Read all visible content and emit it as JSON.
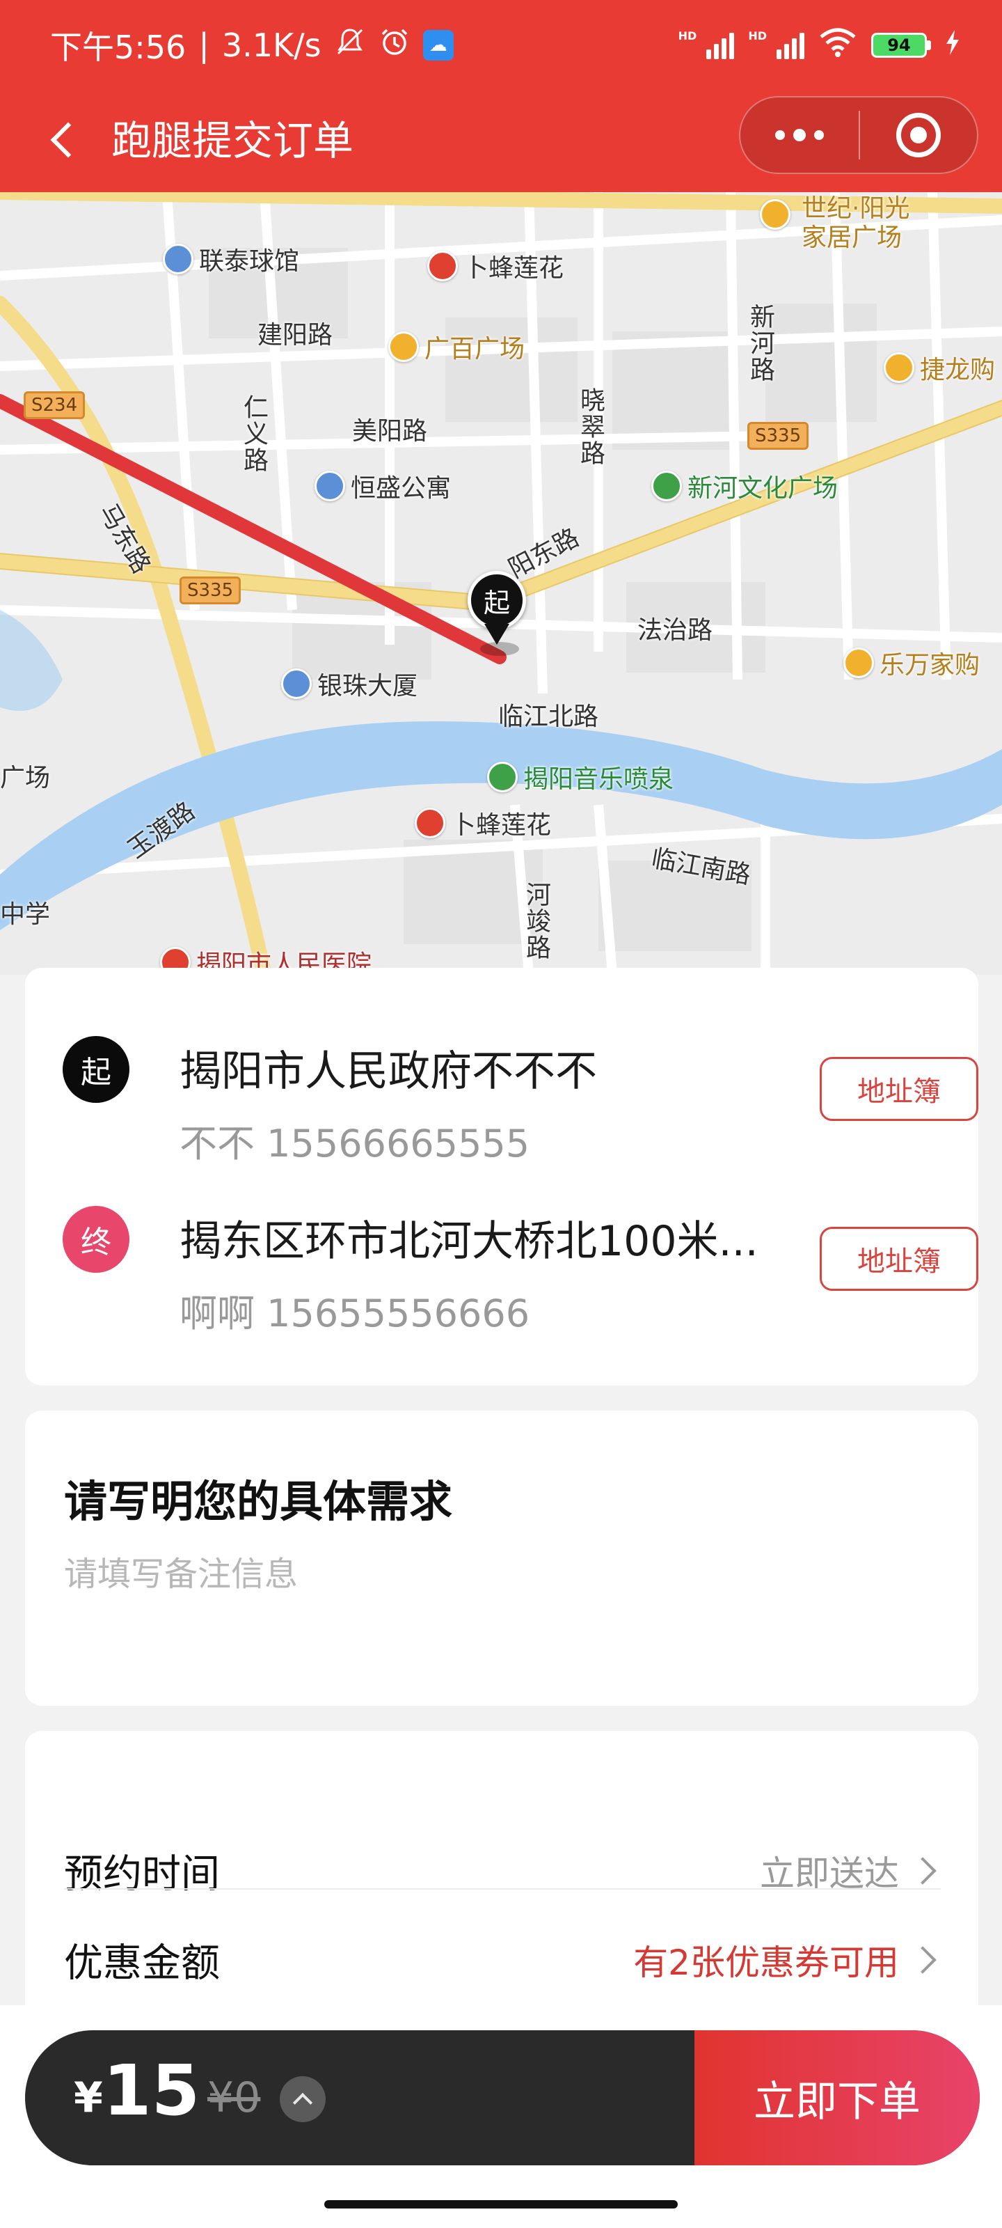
{
  "status_bar": {
    "time": "下午5:56",
    "separator": "|",
    "network_speed": "3.1K/s",
    "battery": "94",
    "icons": [
      "mute-icon",
      "alarm-icon",
      "cloud-app-icon",
      "hd-signal-icon",
      "hd-signal-icon",
      "wifi-icon",
      "battery-icon",
      "charging-icon"
    ]
  },
  "nav": {
    "title": "跑腿提交订单",
    "back_icon": "chevron-left-icon",
    "more_icon": "more-dots-icon",
    "close_icon": "target-ring-icon"
  },
  "map": {
    "pin_label": "起",
    "labels": {
      "shijiyangguang": "世纪·阳光",
      "jiajuguangchang": "家居广场",
      "liantai": "联泰球馆",
      "bufeng1": "卜蜂莲花",
      "jianyang": "建阳路",
      "guangbai": "广百广场",
      "xinhe_road": "新河路",
      "jielong": "捷龙购",
      "s234": "S234",
      "renyi": "仁义路",
      "meiyang": "美阳路",
      "xiaocui": "晓翠路",
      "s335_right": "S335",
      "hengsheng": "恒盛公寓",
      "xinhe_wenhua": "新河文化广场",
      "madong": "马东路",
      "yangdong": "阳东路",
      "s335_left": "S335",
      "fazhi": "法治路",
      "lewan": "乐万家购",
      "yinzhu": "银珠大厦",
      "linjiang_bei": "临江北路",
      "guang_left": "广场",
      "yinyue": "揭阳音乐喷泉",
      "yudu": "玉渡路",
      "bufeng2": "卜蜂莲花",
      "linjiang_nan": "临江南路",
      "zhongxue": "中学",
      "hejing": "河竣路",
      "renmin_yiyuan": "揭阳市人民医院"
    }
  },
  "addresses": [
    {
      "badge": "起",
      "title": "揭阳市人民政府不不不",
      "contact": "不不 15566665555",
      "button": "地址簿"
    },
    {
      "badge": "终",
      "title": "揭东区环市北河大桥北100米...",
      "contact": "啊啊 15655556666",
      "button": "地址簿"
    }
  ],
  "need": {
    "title": "请写明您的具体需求",
    "placeholder": "请填写备注信息",
    "value": ""
  },
  "options": [
    {
      "label": "预约时间",
      "value": "立即送达"
    },
    {
      "label": "优惠金额",
      "value": "有2张优惠券可用"
    }
  ],
  "order": {
    "currency": "¥",
    "price": "15",
    "original_price": "¥0",
    "submit": "立即下单",
    "colors": {
      "accent": "#e83b34",
      "bar": "#2a2a2a",
      "end_badge": "#e8466a"
    }
  }
}
